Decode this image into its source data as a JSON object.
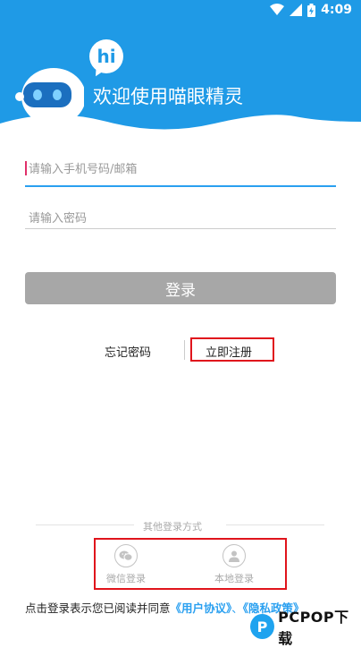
{
  "status_bar": {
    "time": "4:09"
  },
  "header": {
    "bubble_text": "hi",
    "welcome": "欢迎使用喵眼精灵",
    "colors": {
      "background": "#1f9ae6"
    }
  },
  "form": {
    "phone_placeholder": "请输入手机号码/邮箱",
    "password_placeholder": "请输入密码",
    "login_label": "登录"
  },
  "links": {
    "forgot": "忘记密码",
    "register": "立即注册"
  },
  "other_login": {
    "title": "其他登录方式",
    "options": [
      {
        "label": "微信登录",
        "icon": "wechat-icon"
      },
      {
        "label": "本地登录",
        "icon": "user-icon"
      }
    ]
  },
  "agreement": {
    "prefix": "点击登录表示您已阅读并同意",
    "user_agreement": "《用户协议》",
    "privacy": "《隐私政策》",
    "sep": "、"
  },
  "watermark": {
    "text": "PCPOP下载",
    "logo": "P"
  }
}
